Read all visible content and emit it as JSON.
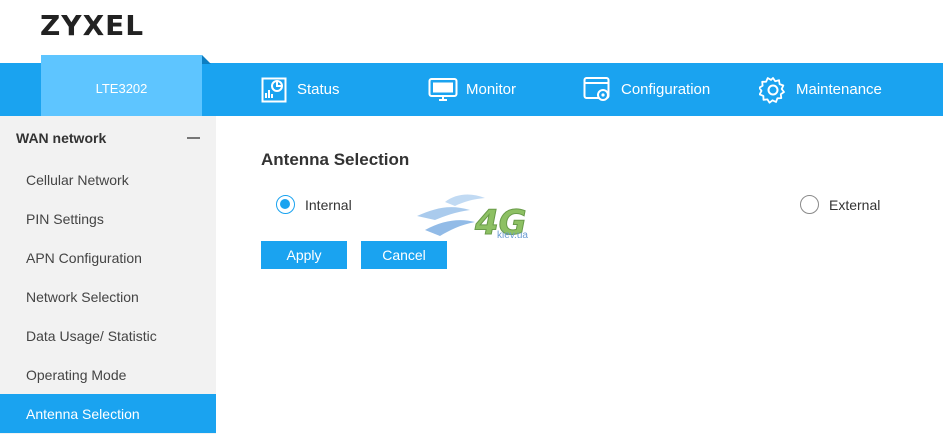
{
  "brand": {
    "logo_text": "ZYXEL"
  },
  "device": {
    "model": "LTE3202"
  },
  "nav": {
    "items": [
      {
        "label": "Status",
        "icon": "status-icon"
      },
      {
        "label": "Monitor",
        "icon": "monitor-icon"
      },
      {
        "label": "Configuration",
        "icon": "configuration-icon",
        "active": true
      },
      {
        "label": "Maintenance",
        "icon": "gear-icon"
      }
    ]
  },
  "sidebar": {
    "section_title": "WAN network",
    "items": [
      {
        "label": "Cellular Network"
      },
      {
        "label": "PIN Settings"
      },
      {
        "label": "APN Configuration"
      },
      {
        "label": "Network Selection"
      },
      {
        "label": "Data Usage/ Statistic"
      },
      {
        "label": "Operating Mode"
      },
      {
        "label": "Antenna Selection",
        "active": true
      }
    ]
  },
  "main": {
    "title": "Antenna Selection",
    "options": [
      {
        "label": "Internal",
        "checked": true
      },
      {
        "label": "External",
        "checked": false
      }
    ],
    "apply_label": "Apply",
    "cancel_label": "Cancel"
  },
  "watermark": {
    "logo": "4G",
    "domain": "kiev.ua"
  },
  "colors": {
    "accent": "#1aa3f0",
    "device_tab": "#5ec5ff",
    "sidebar_bg": "#f2f2f2"
  }
}
